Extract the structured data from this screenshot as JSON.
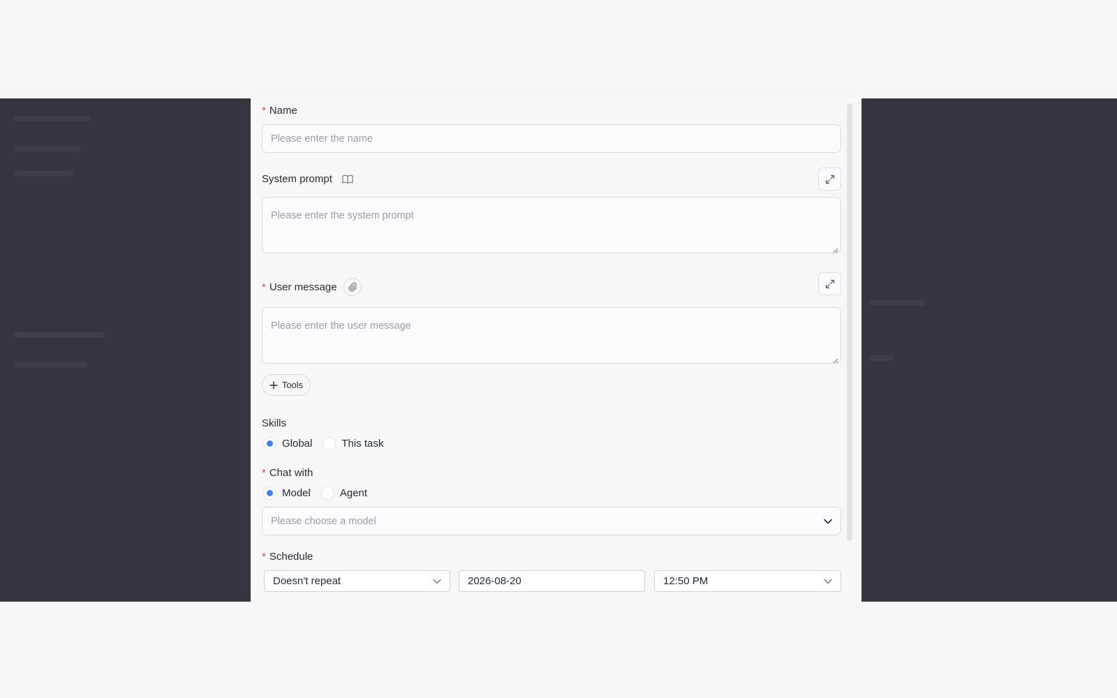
{
  "form": {
    "name": {
      "label": "Name",
      "placeholder": "Please enter the name"
    },
    "system_prompt": {
      "label": "System prompt",
      "placeholder": "Please enter the system prompt"
    },
    "user_message": {
      "label": "User message",
      "placeholder": "Please enter the user message"
    },
    "tools_label": "Tools",
    "skills": {
      "label": "Skills",
      "options": [
        "Global",
        "This task"
      ],
      "selected": "Global"
    },
    "chat_with": {
      "label": "Chat with",
      "options": [
        "Model",
        "Agent"
      ],
      "selected": "Model"
    },
    "model_select": {
      "placeholder": "Please choose a model"
    },
    "schedule": {
      "label": "Schedule",
      "repeat": "Doesn't repeat",
      "date": "2026-08-20",
      "time": "12:50 PM"
    }
  },
  "colors": {
    "backdrop": "#363641",
    "dialog": "#f7f7f7",
    "accent": "#3b82f6",
    "required": "#e5484d"
  },
  "icons": [
    "book-icon",
    "paperclip-icon",
    "expand-icon",
    "plus-icon",
    "chevron-down-icon"
  ]
}
